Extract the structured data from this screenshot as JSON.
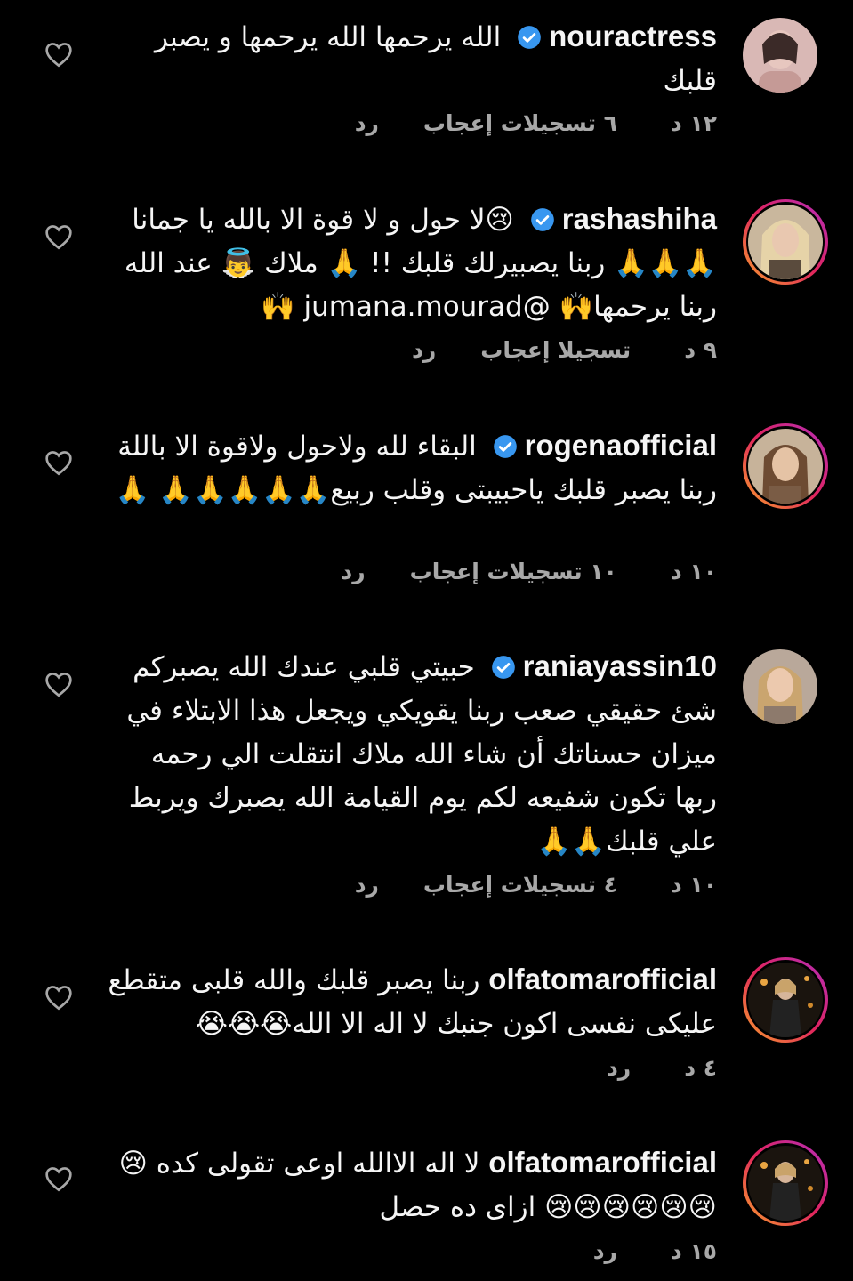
{
  "ui": {
    "accent_verified": "#3897f0",
    "meta_color": "#a8a8a8",
    "text_color": "#f5f5f5",
    "heart_icon": "heart-outline-icon"
  },
  "comments": [
    {
      "username": "nouractress",
      "verified": true,
      "story_ring": false,
      "text_html": "الله يرحمها الله يرحمها و يصبر قلبك",
      "time": "١٢ د",
      "likes": "٦ تسجيلات إعجاب",
      "reply": "رد"
    },
    {
      "username": "rashashiha",
      "verified": true,
      "story_ring": true,
      "text_html": "😢لا حول و لا قوة الا بالله يا جمانا 🙏🙏🙏 ربنا يصبيرلك قلبك !! 🙏 ملاك 👼 عند الله ربنا يرحمها🙌 @jumana.mourad 🙌",
      "time": "٩ د",
      "likes": "تسجيلا إعجاب",
      "reply": "رد"
    },
    {
      "username": "rogenaofficial",
      "verified": true,
      "story_ring": true,
      "text_html": "البقاء لله ولاحول ولاقوة الا باللة ربنا يصبر قلبك ياحبيبتى وقلب ربيع🙏🙏🙏🙏🙏 🙏",
      "time": "١٠ د",
      "likes": "١٠ تسجيلات إعجاب",
      "reply": "رد"
    },
    {
      "username": "raniayassin10",
      "verified": true,
      "story_ring": false,
      "text_html": "حبيتي قلبي عندك الله يصبركم شئ حقيقي صعب ربنا يقويكي ويجعل هذا الابتلاء  في ميزان حسناتك أن شاء الله ملاك انتقلت الي رحمه ربها تكون شفيعه لكم  يوم القيامة  الله يصبرك ويربط علي قلبك🙏🙏",
      "time": "١٠ د",
      "likes": "٤ تسجيلات إعجاب",
      "reply": "رد"
    },
    {
      "username": "olfatomarofficial",
      "verified": false,
      "story_ring": true,
      "text_html": "ربنا يصبر قلبك والله قلبى متقطع عليكى نفسى اكون جنبك لا اله الا الله😭😭😭",
      "time": "٤ د",
      "likes": "",
      "reply": "رد"
    },
    {
      "username": "olfatomarofficial",
      "verified": false,
      "story_ring": true,
      "text_html": "لا اله الاالله اوعى تقولى كده 😢 😢😢😢😢😢😢 ازاى ده حصل",
      "time": "١٥ د",
      "likes": "",
      "reply": "رد"
    }
  ]
}
